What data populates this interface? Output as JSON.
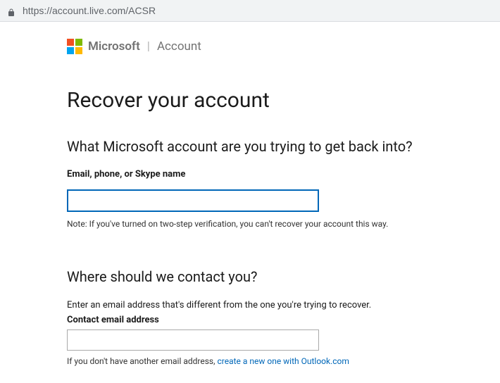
{
  "browser": {
    "url": "https://account.live.com/ACSR"
  },
  "header": {
    "brand": "Microsoft",
    "separator": "|",
    "product": "Account"
  },
  "page": {
    "title": "Recover your account"
  },
  "section1": {
    "heading": "What Microsoft account are you trying to get back into?",
    "field_label": "Email, phone, or Skype name",
    "field_value": "",
    "note": "Note: If you've turned on two-step verification, you can't recover your account this way."
  },
  "section2": {
    "heading": "Where should we contact you?",
    "description": "Enter an email address that's different from the one you're trying to recover.",
    "field_label": "Contact email address",
    "field_value": "",
    "helper_prefix": "If you don't have another email address, ",
    "helper_link": "create a new one with Outlook.com"
  }
}
